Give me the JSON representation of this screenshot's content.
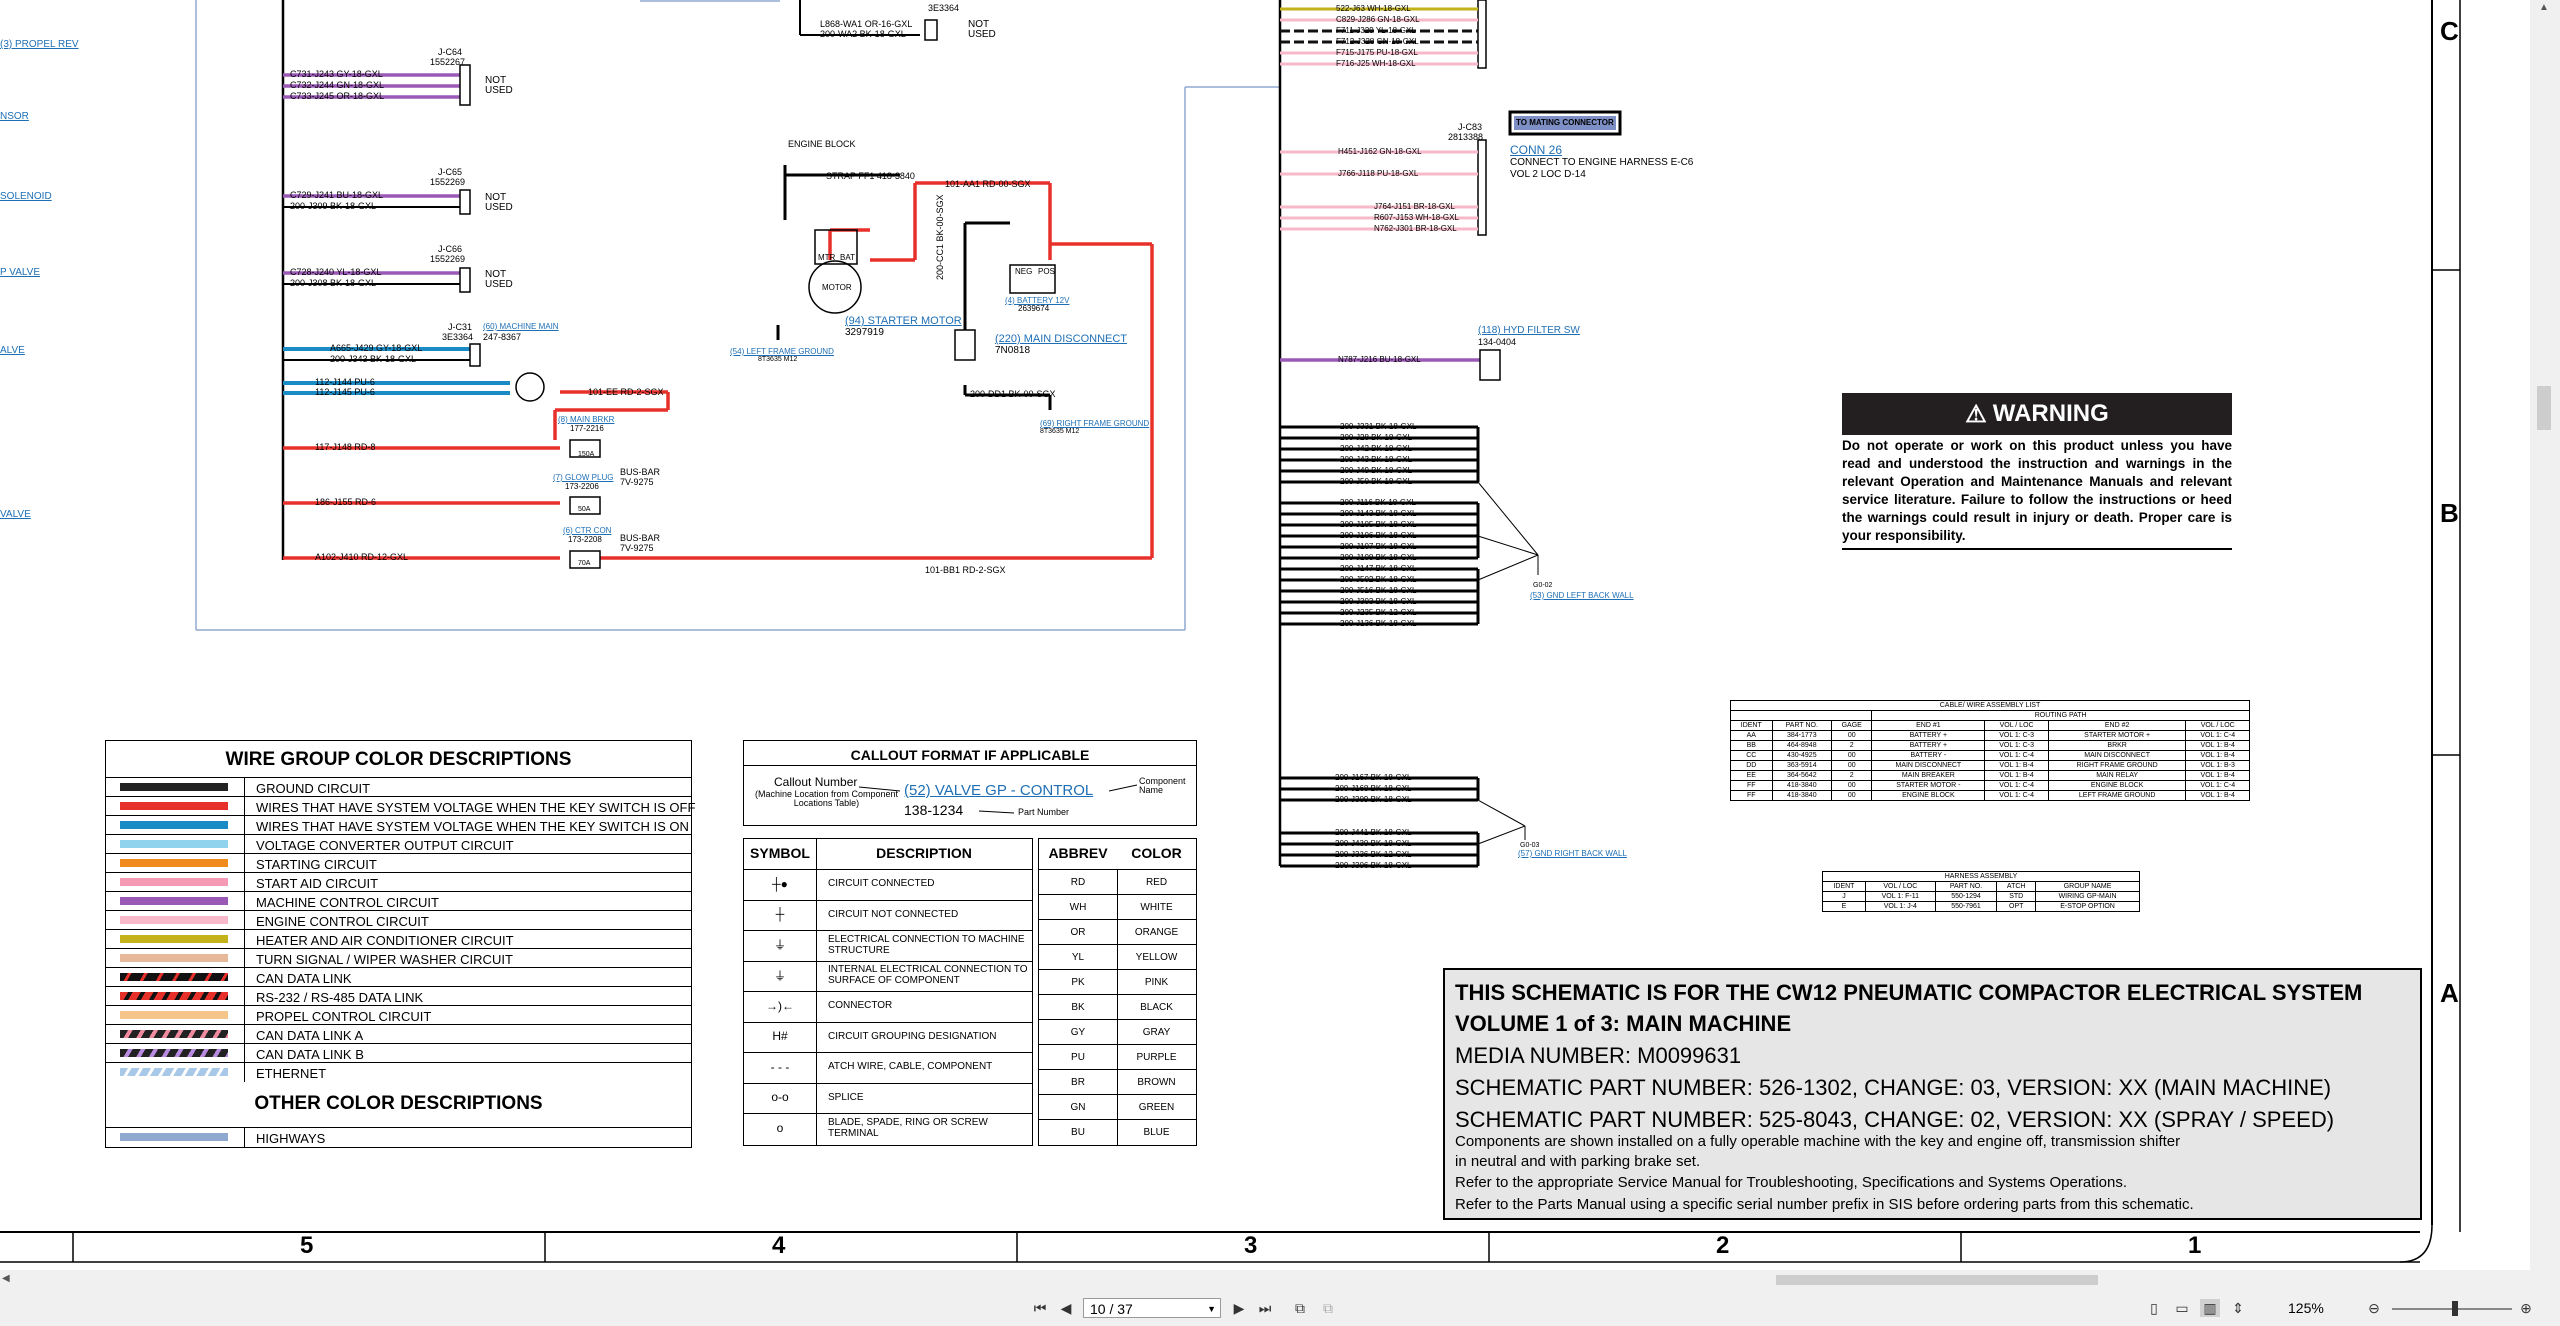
{
  "wire_group": {
    "title": "WIRE GROUP COLOR DESCRIPTIONS",
    "items": [
      {
        "label": "GROUND CIRCUIT",
        "color": "#222222",
        "pattern": "solid"
      },
      {
        "label": "WIRES THAT HAVE SYSTEM VOLTAGE WHEN THE KEY SWITCH IS OFF",
        "color": "#e8302b",
        "pattern": "solid"
      },
      {
        "label": "WIRES THAT HAVE SYSTEM VOLTAGE WHEN THE KEY SWITCH IS ON",
        "color": "#1a8bc4",
        "pattern": "solid"
      },
      {
        "label": "VOLTAGE CONVERTER OUTPUT CIRCUIT",
        "color": "#8fd4ec",
        "pattern": "solid"
      },
      {
        "label": "STARTING CIRCUIT",
        "color": "#f08a1c",
        "pattern": "solid"
      },
      {
        "label": "START AID CIRCUIT",
        "color": "#f49ab4",
        "pattern": "solid"
      },
      {
        "label": "MACHINE CONTROL CIRCUIT",
        "color": "#9b59b6",
        "pattern": "solid"
      },
      {
        "label": "ENGINE CONTROL CIRCUIT",
        "color": "#f7b9c9",
        "pattern": "solid"
      },
      {
        "label": "HEATER AND AIR CONDITIONER CIRCUIT",
        "color": "#c4b21a",
        "pattern": "solid"
      },
      {
        "label": "TURN SIGNAL / WIPER WASHER CIRCUIT",
        "color": "#e8b89a",
        "pattern": "solid"
      },
      {
        "label": "CAN DATA LINK",
        "color": "#111111",
        "pattern": "stripe-yellow"
      },
      {
        "label": "RS-232 / RS-485 DATA LINK",
        "color": "#e8302b",
        "pattern": "stripe-black"
      },
      {
        "label": "PROPEL CONTROL CIRCUIT",
        "color": "#f5c58a",
        "pattern": "solid"
      },
      {
        "label": "CAN DATA LINK A",
        "color": "#222222",
        "pattern": "stripe-pink"
      },
      {
        "label": "CAN DATA LINK B",
        "color": "#222222",
        "pattern": "stripe-purple"
      },
      {
        "label": "ETHERNET",
        "color": "#a8c8e8",
        "pattern": "stripe-white"
      }
    ],
    "other_title": "OTHER COLOR DESCRIPTIONS",
    "other_items": [
      {
        "label": "HIGHWAYS",
        "color": "#8fa8d0",
        "pattern": "solid"
      }
    ]
  },
  "callout": {
    "title": "CALLOUT FORMAT IF APPLICABLE",
    "callout_number": "Callout Number",
    "callout_note": "(Machine Location from Component Locations Table)",
    "example_link": "(52) VALVE GP - CONTROL",
    "example_part": "138-1234",
    "component_name": "Component Name",
    "part_number": "Part Number"
  },
  "symbols": {
    "headers": [
      "SYMBOL",
      "DESCRIPTION"
    ],
    "rows": [
      {
        "glyph": "┼●",
        "description": "CIRCUIT CONNECTED"
      },
      {
        "glyph": "┼",
        "description": "CIRCUIT NOT CONNECTED"
      },
      {
        "glyph": "⏚",
        "description": "ELECTRICAL CONNECTION TO MACHINE STRUCTURE"
      },
      {
        "glyph": "⏚",
        "description": "INTERNAL ELECTRICAL CONNECTION TO SURFACE OF COMPONENT"
      },
      {
        "glyph": "→)←",
        "description": "CONNECTOR"
      },
      {
        "glyph": "H#",
        "description": "CIRCUIT GROUPING DESIGNATION"
      },
      {
        "glyph": "- - -",
        "description": "ATCH WIRE, CABLE, COMPONENT"
      },
      {
        "glyph": "o-o",
        "description": "SPLICE"
      },
      {
        "glyph": "o",
        "description": "BLADE, SPADE, RING OR SCREW TERMINAL"
      }
    ]
  },
  "abbrev": {
    "headers": [
      "ABBREV",
      "COLOR"
    ],
    "rows": [
      [
        "RD",
        "RED"
      ],
      [
        "WH",
        "WHITE"
      ],
      [
        "OR",
        "ORANGE"
      ],
      [
        "YL",
        "YELLOW"
      ],
      [
        "PK",
        "PINK"
      ],
      [
        "BK",
        "BLACK"
      ],
      [
        "GY",
        "GRAY"
      ],
      [
        "PU",
        "PURPLE"
      ],
      [
        "BR",
        "BROWN"
      ],
      [
        "GN",
        "GREEN"
      ],
      [
        "BU",
        "BLUE"
      ]
    ]
  },
  "title_block": {
    "line1": "THIS SCHEMATIC IS FOR THE CW12 PNEUMATIC COMPACTOR ELECTRICAL SYSTEM",
    "line2": "VOLUME 1 of 3: MAIN MACHINE",
    "line3": "MEDIA NUMBER: M0099631",
    "line4": "SCHEMATIC PART NUMBER: 526-1302, CHANGE: 03, VERSION: XX (MAIN MACHINE)",
    "line5": "SCHEMATIC PART NUMBER: 525-8043, CHANGE: 02, VERSION: XX (SPRAY / SPEED)",
    "line6": "Components are shown installed on a fully operable machine with the key and engine off, transmission shifter",
    "line7": "in neutral and with parking brake set.",
    "line8": "Refer to the appropriate Service Manual for Troubleshooting, Specifications and Systems Operations.",
    "line9": "Refer to the Parts Manual using a specific serial number prefix in SIS before ordering parts from this schematic."
  },
  "warning": {
    "title": "WARNING",
    "text": "Do not operate or work on this product unless you have read and understood the instruction and warnings in the relevant Operation and Maintenance Manuals and relevant service literature. Failure to follow the instructions or heed the warnings could result in injury or death. Proper care is your responsibility."
  },
  "cable_list": {
    "title": "CABLE/ WIRE ASSEMBLY LIST",
    "routing": "ROUTING PATH",
    "headers": [
      "IDENT",
      "PART NO.",
      "GAGE",
      "END #1",
      "VOL / LOC",
      "END #2",
      "VOL / LOC"
    ],
    "rows": [
      [
        "AA",
        "384-1773",
        "00",
        "BATTERY +",
        "VOL 1: C-3",
        "STARTER MOTOR +",
        "VOL 1: C-4"
      ],
      [
        "BB",
        "464-8948",
        "2",
        "BATTERY +",
        "VOL 1: C-3",
        "BRKR",
        "VOL 1: B-4"
      ],
      [
        "CC",
        "430-4925",
        "00",
        "BATTERY -",
        "VOL 1: C-4",
        "MAIN DISCONNECT",
        "VOL 1: B-4"
      ],
      [
        "DD",
        "363-5914",
        "00",
        "MAIN DISCONNECT",
        "VOL 1: B-4",
        "RIGHT FRAME GROUND",
        "VOL 1: B-3"
      ],
      [
        "EE",
        "364-5642",
        "2",
        "MAIN BREAKER",
        "VOL 1: B-4",
        "MAIN RELAY",
        "VOL 1: B-4"
      ],
      [
        "FF",
        "418-3840",
        "00",
        "STARTER MOTOR -",
        "VOL 1: C-4",
        "ENGINE BLOCK",
        "VOL 1: C-4"
      ],
      [
        "FF",
        "418-3840",
        "00",
        "ENGINE BLOCK",
        "VOL 1: C-4",
        "LEFT FRAME GROUND",
        "VOL 1: B-4"
      ]
    ]
  },
  "harness": {
    "title": "HARNESS ASSEMBLY",
    "headers": [
      "IDENT",
      "VOL / LOC",
      "PART NO.",
      "ATCH",
      "GROUP NAME"
    ],
    "rows": [
      [
        "J",
        "VOL 1: F-11",
        "550-1294",
        "STD",
        "WIRING GP-MAIN"
      ],
      [
        "E",
        "VOL 1: J-4",
        "550-7961",
        "OPT",
        "E-STOP OPTION"
      ]
    ]
  },
  "schematic": {
    "left_links": [
      "(3) PROPEL REV",
      "NSOR",
      "SOLENOID",
      "P VALVE",
      "ALVE",
      "VALVE"
    ],
    "connectors": {
      "jc64": [
        "J-C64",
        "1552267"
      ],
      "jc65": [
        "J-C65",
        "1552269"
      ],
      "jc66": [
        "J-C66",
        "1552269"
      ],
      "jc31": [
        "J-C31",
        "3E3364"
      ],
      "jc83": [
        "J-C83",
        "2813388"
      ],
      "top": "3E3364"
    },
    "not_used": "NOT USED",
    "wires_c64": [
      "C731-J243  GY-18-GXL",
      "C732-J244  GN-18-GXL",
      "C733-J245  OR-18-GXL"
    ],
    "wires_c65": [
      "C729-J241  BU-18-GXL",
      "200-J309  BK-18-GXL"
    ],
    "wires_c66": [
      "C728-J240  YL-18-GXL",
      "200-J308  BK-18-GXL"
    ],
    "wires_c31": [
      "A665-J429  GY-18-GXL",
      "200-J343  BK-18-GXL"
    ],
    "wires_blue": [
      "112-J144  PU-6",
      "112-J145  PU-6"
    ],
    "wires_red": [
      "117-J148  RD-8",
      "186-J155  RD-6",
      "A102-J410  RD-12-GXL"
    ],
    "top_wires": [
      "L868-WA1  OR-16-GXL",
      "200-WA2  BK-18-GXL"
    ],
    "engine_block": "ENGINE BLOCK",
    "strap": "STRAP FF1 418-3840",
    "aa1": "101-AA1  RD-00-SGX",
    "motor": "MOTOR",
    "mtr": "MTR",
    "bat": "BAT",
    "starter_link": "(94) STARTER MOTOR",
    "starter_pn": "3297919",
    "battery_link": "(4) BATTERY 12V",
    "battery_pn": "2639674",
    "neg": "NEG",
    "pos": "POS",
    "disconnect_link": "(220) MAIN DISCONNECT",
    "disconnect_pn": "7N0818",
    "cc1": "200-CC1  BK-00-SGX",
    "dd1": "200-DD1  BK-00-SGX",
    "left_ground": "(54) LEFT FRAME GROUND",
    "left_ground_pn": "8T3635 M12",
    "right_ground": "(69) RIGHT FRAME GROUND",
    "right_ground_pn": "8T3635 M12",
    "relay_link": "(60) MACHINE MAIN",
    "relay_pn": "247-8367",
    "ee": "101-EE  RD-2-SGX",
    "bb1": "101-BB1  RD-2-SGX",
    "main_brkr": "(8) MAIN BRKR",
    "main_brkr_pn": "177-2216",
    "glow": "(7) GLOW PLUG",
    "glow_pn": "173-2206",
    "ctr": "(6) CTR CON",
    "ctr_pn": "173-2208",
    "bus_bar": "BUS-BAR",
    "bus_pn": "7V-9275",
    "fuse_150": "150A",
    "fuse_50": "50A",
    "fuse_70": "70A",
    "right_top_wires": [
      "522-J63  WH-18-GXL",
      "C829-J286  GN-18-GXL",
      "F711-J329  YL-18-GXL",
      "F712-J328  GN-18-GXL",
      "F715-J175  PU-18-GXL",
      "F716-J25  WH-18-GXL"
    ],
    "mating": "TO MATING CONNECTOR",
    "conn26": "CONN 26",
    "conn26_desc1": "CONNECT TO ENGINE HARNESS E-C6",
    "conn26_desc2": "VOL 2 LOC D-14",
    "c83_wires": [
      "H451-J162  GN-18-GXL",
      "J766-J118  PU-18-GXL",
      "J764-J151  BR-18-GXL",
      "R607-J153  WH-18-GXL",
      "N762-J301  BR-18-GXL"
    ],
    "hyd_link": "(118) HYD FILTER SW",
    "hyd_pn": "134-0404",
    "hyd_wire": "N787-J216  BU-18-GXL",
    "gnd_wires_1": [
      "200-J331  BK-18-GXL",
      "200-J28  BK-18-GXL",
      "200-J42  BK-18-GXL",
      "200-J43  BK-18-GXL",
      "200-J49  BK-18-GXL",
      "200-J50  BK-18-GXL"
    ],
    "gnd_wires_2": [
      "200-J116  BK-18-GXL",
      "200-J143  BK-18-GXL",
      "200-J105  BK-18-GXL",
      "200-J106  BK-18-GXL",
      "200-J107  BK-18-GXL",
      "200-J108  BK-18-GXL"
    ],
    "gnd_wires_3": [
      "200-J147  BK-18-GXL",
      "200-J502  BK-18-GXL",
      "200-J516  BK-18-GXL",
      "200-J303  BK-18-GXL",
      "200-J235  BK-12-GXL",
      "200-J136  BK-18-GXL"
    ],
    "g002": "G0-02",
    "left_back_wall": "(53) GND LEFT BACK WALL",
    "gnd_wires_4": [
      "200-J167  BK-18-GXL",
      "200-J168  BK-18-GXL",
      "200-J309  BK-18-GXL"
    ],
    "gnd_wires_5": [
      "200-J441  BK-18-GXL",
      "200-J430  BK-18-GXL",
      "200-J336  BK-12-GXL",
      "200-J306  BK-18-GXL"
    ],
    "g003": "G0-03",
    "right_back_wall": "(57) GND RIGHT BACK WALL"
  },
  "zones": {
    "columns": [
      "5",
      "4",
      "3",
      "2",
      "1"
    ],
    "rows": [
      "C",
      "B",
      "A"
    ]
  },
  "toolbar": {
    "page": "10 / 37",
    "zoom": "125%"
  }
}
